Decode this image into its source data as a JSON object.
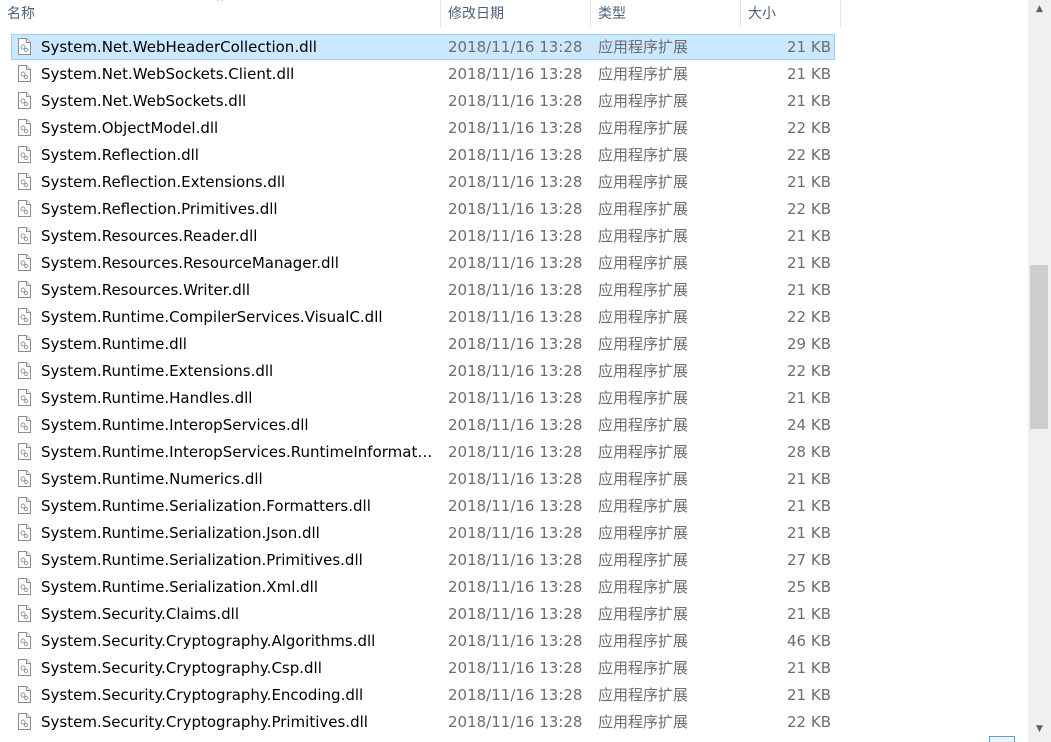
{
  "columns": {
    "name": "名称",
    "date": "修改日期",
    "type": "类型",
    "size": "大小"
  },
  "sort_indicator": "^",
  "icons": {
    "file": "dll-file-icon",
    "scroll_up": "chevron-up-icon",
    "scroll_down": "chevron-down-icon"
  },
  "scroll_up_glyph": "▲",
  "scroll_down_glyph": "▼",
  "colors": {
    "selection_bg": "#cce8ff",
    "selection_border": "#99d1ff",
    "header_text": "#4c607a",
    "secondary_text": "#6d6d6d"
  },
  "scrollbar": {
    "position_fraction": 0.46
  },
  "files": [
    {
      "name": "System.Net.WebHeaderCollection.dll",
      "date": "2018/11/16 13:28",
      "type": "应用程序扩展",
      "size": "21 KB",
      "selected": true
    },
    {
      "name": "System.Net.WebSockets.Client.dll",
      "date": "2018/11/16 13:28",
      "type": "应用程序扩展",
      "size": "21 KB"
    },
    {
      "name": "System.Net.WebSockets.dll",
      "date": "2018/11/16 13:28",
      "type": "应用程序扩展",
      "size": "21 KB"
    },
    {
      "name": "System.ObjectModel.dll",
      "date": "2018/11/16 13:28",
      "type": "应用程序扩展",
      "size": "22 KB"
    },
    {
      "name": "System.Reflection.dll",
      "date": "2018/11/16 13:28",
      "type": "应用程序扩展",
      "size": "22 KB"
    },
    {
      "name": "System.Reflection.Extensions.dll",
      "date": "2018/11/16 13:28",
      "type": "应用程序扩展",
      "size": "21 KB"
    },
    {
      "name": "System.Reflection.Primitives.dll",
      "date": "2018/11/16 13:28",
      "type": "应用程序扩展",
      "size": "22 KB"
    },
    {
      "name": "System.Resources.Reader.dll",
      "date": "2018/11/16 13:28",
      "type": "应用程序扩展",
      "size": "21 KB"
    },
    {
      "name": "System.Resources.ResourceManager.dll",
      "date": "2018/11/16 13:28",
      "type": "应用程序扩展",
      "size": "21 KB"
    },
    {
      "name": "System.Resources.Writer.dll",
      "date": "2018/11/16 13:28",
      "type": "应用程序扩展",
      "size": "21 KB"
    },
    {
      "name": "System.Runtime.CompilerServices.VisualC.dll",
      "date": "2018/11/16 13:28",
      "type": "应用程序扩展",
      "size": "22 KB"
    },
    {
      "name": "System.Runtime.dll",
      "date": "2018/11/16 13:28",
      "type": "应用程序扩展",
      "size": "29 KB"
    },
    {
      "name": "System.Runtime.Extensions.dll",
      "date": "2018/11/16 13:28",
      "type": "应用程序扩展",
      "size": "22 KB"
    },
    {
      "name": "System.Runtime.Handles.dll",
      "date": "2018/11/16 13:28",
      "type": "应用程序扩展",
      "size": "21 KB"
    },
    {
      "name": "System.Runtime.InteropServices.dll",
      "date": "2018/11/16 13:28",
      "type": "应用程序扩展",
      "size": "24 KB"
    },
    {
      "name": "System.Runtime.InteropServices.RuntimeInformatio...",
      "date": "2018/11/16 13:28",
      "type": "应用程序扩展",
      "size": "28 KB"
    },
    {
      "name": "System.Runtime.Numerics.dll",
      "date": "2018/11/16 13:28",
      "type": "应用程序扩展",
      "size": "21 KB"
    },
    {
      "name": "System.Runtime.Serialization.Formatters.dll",
      "date": "2018/11/16 13:28",
      "type": "应用程序扩展",
      "size": "21 KB"
    },
    {
      "name": "System.Runtime.Serialization.Json.dll",
      "date": "2018/11/16 13:28",
      "type": "应用程序扩展",
      "size": "21 KB"
    },
    {
      "name": "System.Runtime.Serialization.Primitives.dll",
      "date": "2018/11/16 13:28",
      "type": "应用程序扩展",
      "size": "27 KB"
    },
    {
      "name": "System.Runtime.Serialization.Xml.dll",
      "date": "2018/11/16 13:28",
      "type": "应用程序扩展",
      "size": "25 KB"
    },
    {
      "name": "System.Security.Claims.dll",
      "date": "2018/11/16 13:28",
      "type": "应用程序扩展",
      "size": "21 KB"
    },
    {
      "name": "System.Security.Cryptography.Algorithms.dll",
      "date": "2018/11/16 13:28",
      "type": "应用程序扩展",
      "size": "46 KB"
    },
    {
      "name": "System.Security.Cryptography.Csp.dll",
      "date": "2018/11/16 13:28",
      "type": "应用程序扩展",
      "size": "21 KB"
    },
    {
      "name": "System.Security.Cryptography.Encoding.dll",
      "date": "2018/11/16 13:28",
      "type": "应用程序扩展",
      "size": "21 KB"
    },
    {
      "name": "System.Security.Cryptography.Primitives.dll",
      "date": "2018/11/16 13:28",
      "type": "应用程序扩展",
      "size": "22 KB"
    }
  ]
}
